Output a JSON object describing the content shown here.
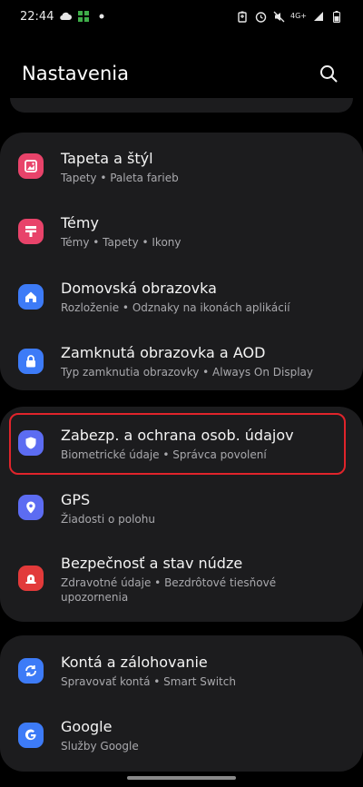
{
  "status_bar": {
    "time": "22:44",
    "network": "4G+",
    "icons_left": [
      "cloud-icon",
      "app-icon",
      "dot-icon"
    ],
    "icons_right": [
      "battery-saver-icon",
      "alarm-icon",
      "mute-icon",
      "signal-icon",
      "battery-icon"
    ]
  },
  "header": {
    "title": "Nastavenia",
    "search_icon": "search-icon"
  },
  "colors": {
    "background": "#000000",
    "card": "#1c1c1e",
    "highlight": "#e0242b",
    "wallpaper_icon": "#e8436a",
    "themes_icon": "#e8436a",
    "home_icon": "#3d7bf7",
    "lock_icon": "#3d7bf7",
    "security_icon": "#5c6cf2",
    "gps_icon": "#5c6cf2",
    "emergency_icon": "#e23a3a",
    "accounts_icon": "#3d7bf7",
    "google_icon": "#3d7bf7"
  },
  "items": [
    {
      "title": "Tapeta a štýl",
      "subtitle": "Tapety  •  Paleta farieb",
      "icon": "wallpaper-icon"
    },
    {
      "title": "Témy",
      "subtitle": "Témy  •  Tapety  •  Ikony",
      "icon": "themes-icon"
    },
    {
      "title": "Domovská obrazovka",
      "subtitle": "Rozloženie  •  Odznaky na ikonách aplikácií",
      "icon": "home-icon"
    },
    {
      "title": "Zamknutá obrazovka a AOD",
      "subtitle": "Typ zamknutia obrazovky  •  Always On Display",
      "icon": "lock-icon"
    },
    {
      "title": "Zabezp. a ochrana osob. údajov",
      "subtitle": "Biometrické údaje  •  Správca povolení",
      "icon": "shield-icon"
    },
    {
      "title": "GPS",
      "subtitle": "Žiadosti o polohu",
      "icon": "location-pin-icon"
    },
    {
      "title": "Bezpečnosť a stav núdze",
      "subtitle": "Zdravotné údaje  •  Bezdrôtové tiesňové upozornenia",
      "icon": "emergency-icon"
    },
    {
      "title": "Kontá a zálohovanie",
      "subtitle": "Spravovať kontá  •  Smart Switch",
      "icon": "sync-icon"
    },
    {
      "title": "Google",
      "subtitle": "Služby Google",
      "icon": "google-icon"
    }
  ]
}
